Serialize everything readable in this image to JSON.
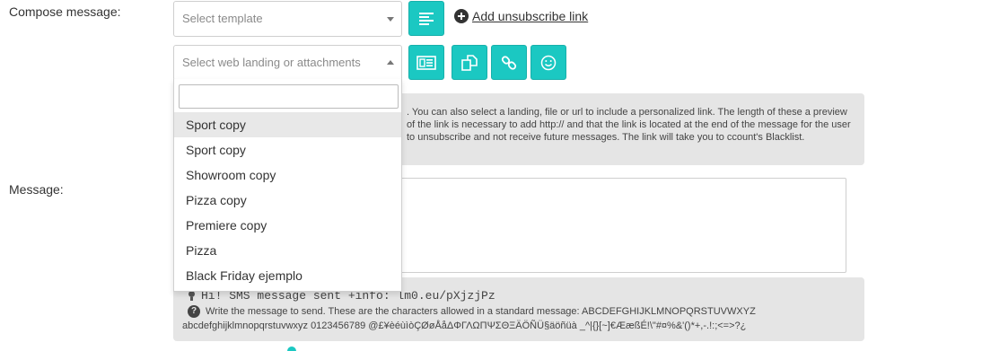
{
  "compose": {
    "label": "Compose message:",
    "template_placeholder": "Select template",
    "landing_placeholder": "Select web landing or attachments",
    "add_unsubscribe": "Add unsubscribe link"
  },
  "toolbar": {
    "icons": [
      "align-left-icon",
      "landing-page-icon",
      "copy-icon",
      "link-icon",
      "smiley-icon"
    ]
  },
  "dropdown": {
    "search_value": "",
    "options": [
      "Sport copy",
      "Sport copy",
      "Showroom copy",
      "Pizza copy",
      "Premiere copy",
      "Pizza",
      "Black Friday ejemplo"
    ],
    "highlighted_index": 0
  },
  "info": {
    "text": ". You can also select a landing, file or url to include a personalized link. The length of these a preview of the link is necessary to add http:// and that the link is located at the end of the message for the user to unsubscribe and not receive future messages. The link will take you to ccount's Blacklist."
  },
  "message": {
    "label": "Message:",
    "value": ""
  },
  "preview": {
    "sms": "Hi! SMS message sent +info: lm0.eu/pXjzjPz",
    "help": "Write the message to send. These are the characters allowed in a standard message: ABCDEFGHIJKLMNOPQRSTUVWXYZ",
    "chars": "abcdefghijklmnopqrstuvwxyz 0123456789 @£¥èéùìòÇØøÅåΔΦΓΛΩΠΨΣΘΞÄÖÑÜ§äöñüà _^|{}[~]€ÆæßÉ!\\\"#¤%&'()*+,-.!:;<=>?¿"
  },
  "colors": {
    "accent": "#1bc8c2",
    "panel": "#e5e5e5"
  }
}
